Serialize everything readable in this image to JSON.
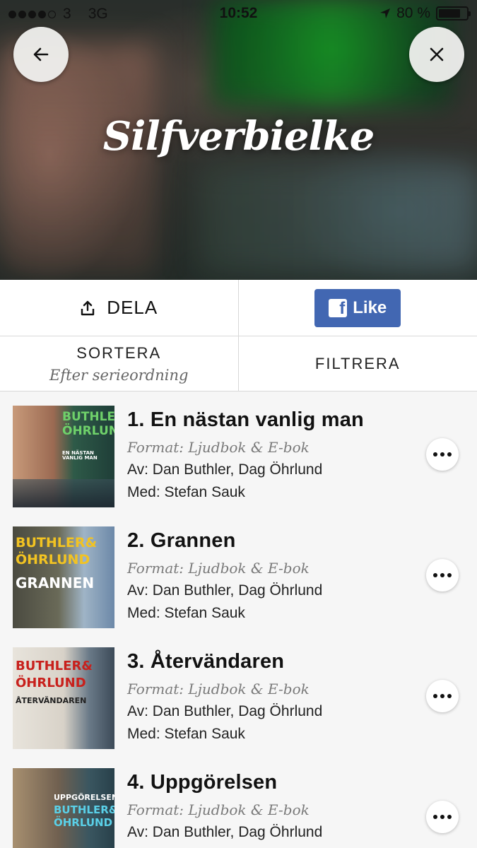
{
  "status_bar": {
    "carrier": "3",
    "network": "3G",
    "time": "10:52",
    "battery": "80 %",
    "battery_level": 0.8,
    "signal_filled": 4,
    "signal_total": 5
  },
  "header": {
    "title": "Silfverbielke",
    "back_icon": "arrow-left-icon",
    "close_icon": "close-icon"
  },
  "actions": {
    "share_label": "DELA",
    "share_icon": "share-icon",
    "facebook_like_label": "Like",
    "facebook_color": "#4267b2",
    "sort_label": "SORTERA",
    "sort_value": "Efter serieordning",
    "filter_label": "FILTRERA"
  },
  "books": [
    {
      "title": "1. En nästan vanlig man",
      "format": "Format: Ljudbok & E-bok",
      "authors": "Av: Dan Buthler, Dag Öhrlund",
      "narrator": "Med: Stefan Sauk",
      "cover_text_top": "BUTHLER&",
      "cover_text_mid": "ÖHRLUND",
      "cover_text_sub": "EN NÄSTAN VANLIG MAN"
    },
    {
      "title": "2. Grannen",
      "format": "Format: Ljudbok & E-bok",
      "authors": "Av: Dan Buthler, Dag Öhrlund",
      "narrator": "Med: Stefan Sauk",
      "cover_text_top": "BUTHLER&",
      "cover_text_mid": "ÖHRLUND",
      "cover_text_sub": "GRANNEN"
    },
    {
      "title": "3. Återvändaren",
      "format": "Format: Ljudbok & E-bok",
      "authors": "Av: Dan Buthler, Dag Öhrlund",
      "narrator": "Med: Stefan Sauk",
      "cover_text_top": "BUTHLER&",
      "cover_text_mid": "ÖHRLUND",
      "cover_text_sub": "ÅTERVÄNDAREN"
    },
    {
      "title": "4. Uppgörelsen",
      "format": "Format: Ljudbok & E-bok",
      "authors": "Av: Dan Buthler, Dag Öhrlund",
      "narrator": "",
      "cover_text_top": "UPPGÖRELSEN",
      "cover_text_mid": "BUTHLER&",
      "cover_text_sub": "ÖHRLUND"
    }
  ]
}
